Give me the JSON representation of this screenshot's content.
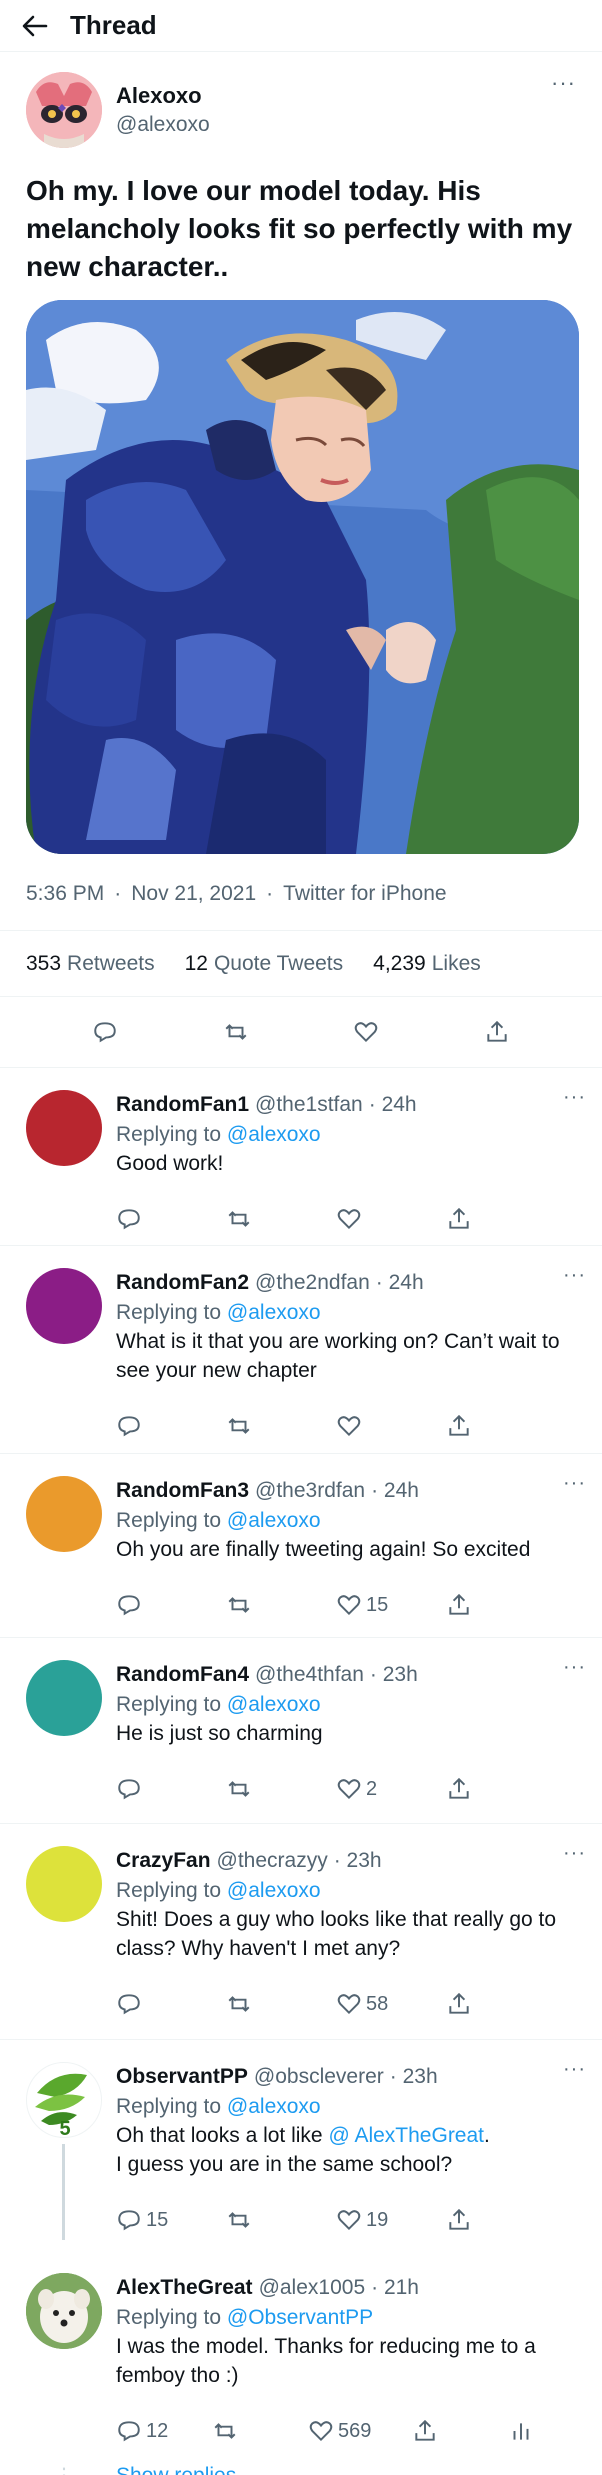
{
  "header": {
    "title": "Thread"
  },
  "main_tweet": {
    "name": "Alexoxo",
    "handle": "@alexoxo",
    "text": "Oh my. I love our model today. His melancholy looks fit so perfectly with my new character..",
    "time": "5:36 PM",
    "date": "Nov 21, 2021",
    "source": "Twitter for iPhone",
    "retweets": "353",
    "retweets_label": "Retweets",
    "quotes": "12",
    "quotes_label": "Quote Tweets",
    "likes": "4,239",
    "likes_label": "Likes"
  },
  "replies": [
    {
      "name": "RandomFan1",
      "handle": "@the1stfan",
      "time": "24h",
      "replying_label": "Replying to",
      "replying_to": "@alexoxo",
      "text": "Good work!",
      "reply_count": "",
      "like_count": "",
      "avatar_color": "#b8262f"
    },
    {
      "name": "RandomFan2",
      "handle": "@the2ndfan",
      "time": "24h",
      "replying_label": "Replying to",
      "replying_to": "@alexoxo",
      "text": "What is it that you are working on? Can’t wait to see your new chapter",
      "reply_count": "",
      "like_count": "",
      "avatar_color": "#8b1d86"
    },
    {
      "name": "RandomFan3",
      "handle": "@the3rdfan",
      "time": "24h",
      "replying_label": "Replying to",
      "replying_to": "@alexoxo",
      "text": "Oh you are finally tweeting again! So excited",
      "reply_count": "",
      "like_count": "15",
      "avatar_color": "#ea9a2c"
    },
    {
      "name": "RandomFan4",
      "handle": "@the4thfan",
      "time": "23h",
      "replying_label": "Replying to",
      "replying_to": "@alexoxo",
      "text": "He is just so charming",
      "reply_count": "",
      "like_count": "2",
      "avatar_color": "#2aa198"
    },
    {
      "name": "CrazyFan",
      "handle": "@thecrazyy",
      "time": "23h",
      "replying_label": "Replying to",
      "replying_to": "@alexoxo",
      "text": "Shit! Does a guy who looks like that really go to class? Why haven't I met any?",
      "reply_count": "",
      "like_count": "58",
      "avatar_color": "#dde23b"
    },
    {
      "name": "ObservantPP",
      "handle": "@obscleverer",
      "time": "23h",
      "replying_label": "Replying to",
      "replying_to": "@alexoxo",
      "text_before": "Oh that looks a lot like ",
      "mention": "@ AlexTheGreat",
      "text_after": ".",
      "text_line2": "I guess you are in the same school?",
      "reply_count": "15",
      "like_count": "19"
    },
    {
      "name": "AlexTheGreat",
      "handle": "@alex1005",
      "time": "21h",
      "replying_label": "Replying to",
      "replying_to": "@ObservantPP",
      "text": "I was the model. Thanks for reducing me to a femboy tho :)",
      "reply_count": "12",
      "like_count": "569"
    }
  ],
  "show_replies": "Show replies",
  "colors": {
    "accent": "#1d9bf0",
    "muted": "#536471",
    "text": "#0f1419",
    "border": "#eff3f4"
  }
}
